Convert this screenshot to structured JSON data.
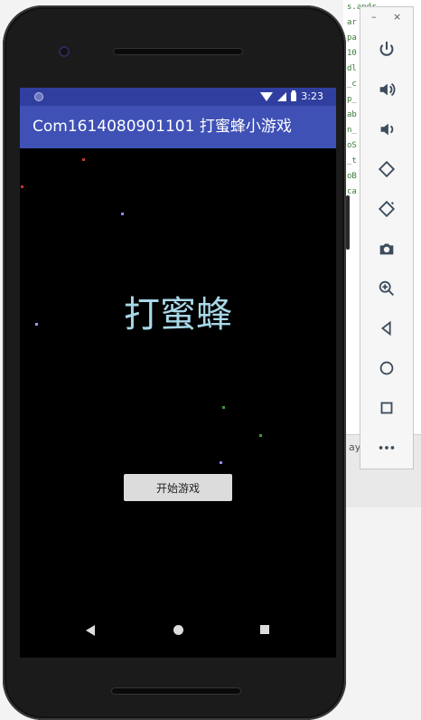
{
  "app_title": "Com1614080901101 打蜜蜂小游戏",
  "status_time": "3:23",
  "game_title": "打蜜蜂",
  "start_button_label": "开始游戏",
  "ide": {
    "code_lines": [
      "s.andr",
      "ar",
      "pa",
      "10",
      "",
      "",
      "dl",
      "_c",
      "p_",
      "ab",
      "",
      "",
      "",
      "",
      "n_",
      "oS",
      "_t",
      "oB",
      "ca"
    ],
    "bottom_text": "ayo"
  },
  "toolbar": {
    "minimize": "–",
    "close": "×",
    "buttons": [
      "power",
      "volume-up",
      "volume-down",
      "rotate-left",
      "rotate-right",
      "screenshot",
      "zoom",
      "back",
      "home",
      "overview",
      "more"
    ]
  },
  "colors": {
    "appbar": "#3f51b5",
    "statusbar": "#303f9f",
    "title_text": "#a8d8e8"
  }
}
